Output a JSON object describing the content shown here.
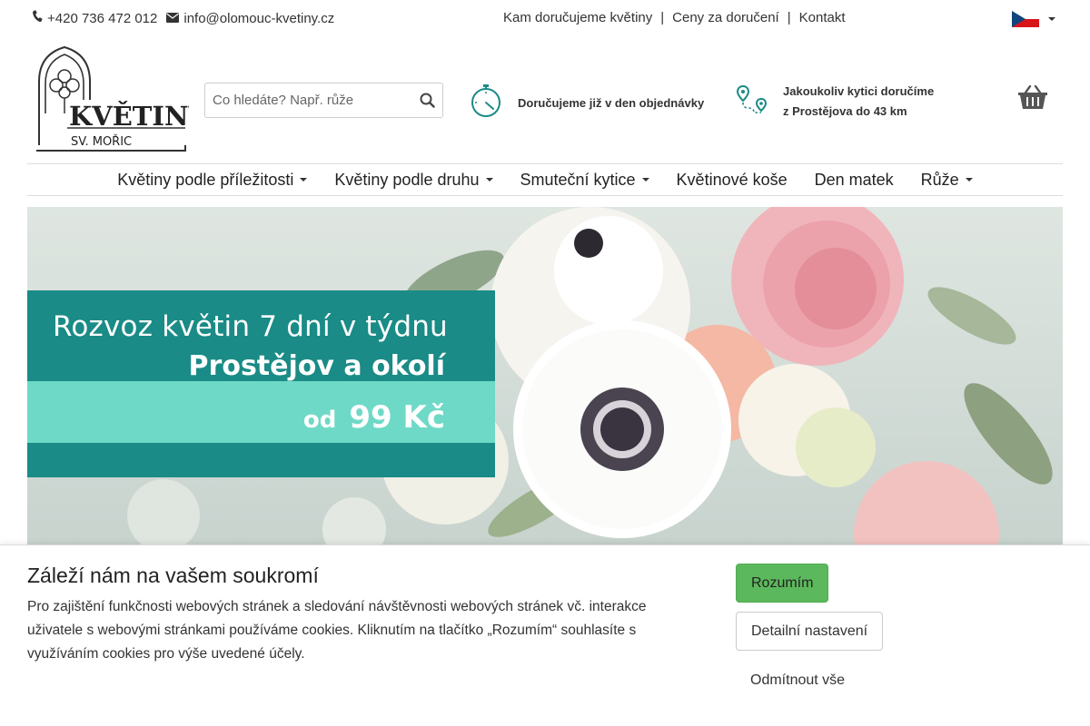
{
  "topbar": {
    "phone": "+420 736 472 012",
    "email": "info@olomouc-kvetiny.cz",
    "links": [
      "Kam doručujeme květiny",
      "Ceny za doručení",
      "Kontakt"
    ],
    "separator": "|",
    "language": "cz-flag-icon"
  },
  "logo": {
    "title": "KVĚTINY",
    "subtitle": "SV. MOŘIC"
  },
  "search": {
    "placeholder": "Co hledáte? Např. růže"
  },
  "info": {
    "delivery_same_day": "Doručujeme již v den objednávky",
    "delivery_range_line1": "Jakoukoliv kytici doručíme",
    "delivery_range_line2": "z Prostějova do 43 km"
  },
  "nav": {
    "items": [
      {
        "label": "Květiny podle příležitosti",
        "dropdown": true
      },
      {
        "label": "Květiny podle druhu",
        "dropdown": true
      },
      {
        "label": "Smuteční kytice",
        "dropdown": true
      },
      {
        "label": "Květinové koše",
        "dropdown": false
      },
      {
        "label": "Den matek",
        "dropdown": false
      },
      {
        "label": "Růže",
        "dropdown": true
      }
    ]
  },
  "banner": {
    "line1": "Rozvoz květin 7 dní v týdnu",
    "line2": "Prostějov a okolí",
    "line3_prefix": "od",
    "line3_price": "99 Kč"
  },
  "cookie": {
    "title": "Záleží nám na vašem soukromí",
    "text": "Pro zajištění funkčnosti webových stránek a sledování návštěvnosti webových stránek vč. interakce uživatele s webovými stránkami používáme cookies. Kliknutím na tlačítko „Rozumím“ souhlasíte s využíváním cookies pro výše uvedené účely.",
    "accept": "Rozumím",
    "details": "Detailní nastavení",
    "reject": "Odmítnout vše"
  },
  "colors": {
    "accent_teal": "#1a8b86",
    "light_teal": "#6fd9c7",
    "accept_green": "#5cb85c"
  }
}
